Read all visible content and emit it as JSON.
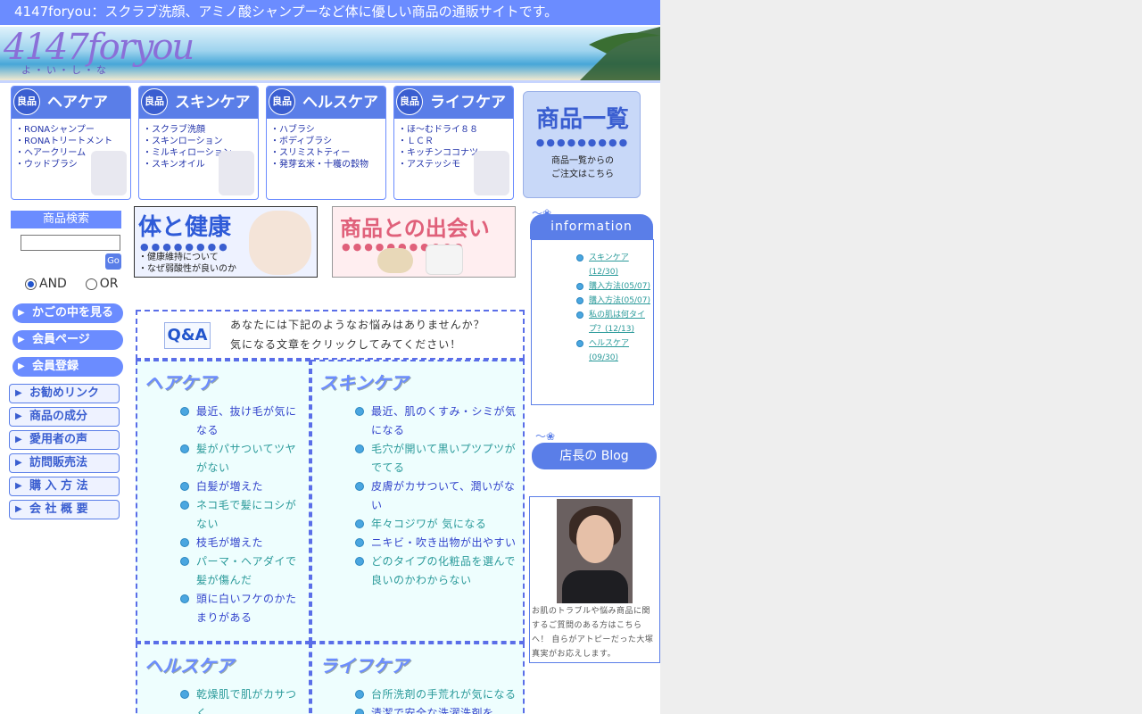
{
  "header": {
    "title": "4147foryou：スクラブ洗顔、アミノ酸シャンプーなど体に優しい商品の通販サイトです。",
    "logo_main": "4147foryou",
    "logo_sub": "よ・い・し・な"
  },
  "categories": [
    {
      "badge": "良品",
      "title": "ヘアケア",
      "items": [
        "・RONAシャンプー",
        "・RONAトリートメント",
        "・ヘアークリーム",
        "・ウッドブラシ"
      ]
    },
    {
      "badge": "良品",
      "title": "スキンケア",
      "items": [
        "・スクラブ洗顔",
        "・スキンローション",
        "・ミルキィローション",
        "・スキンオイル"
      ]
    },
    {
      "badge": "良品",
      "title": "ヘルスケア",
      "items": [
        "・ハブラシ",
        "・ボディブラシ",
        "・スリミストティー",
        "・発芽玄米・十穫の穀物"
      ]
    },
    {
      "badge": "良品",
      "title": "ライフケア",
      "items": [
        "・ほ～むドライ８８",
        "・ＬＣＲ",
        "・キッチンココナツ",
        "・アステッシモ"
      ]
    }
  ],
  "item_list": {
    "title": "商品一覧",
    "dots": "●●●●●●●●●",
    "line1": "商品一覧からの",
    "line2": "ご注文はこちら"
  },
  "search": {
    "heading": "商品検索",
    "value": "",
    "go": "Go",
    "and_label": "AND",
    "or_label": "OR",
    "selected": "AND"
  },
  "nav_primary": [
    "かごの中を見る",
    "会員ページ",
    "会員登録"
  ],
  "nav_secondary": [
    "お勧めリンク",
    "商品の成分",
    "愛用者の声",
    "訪問販売法",
    "購 入 方 法",
    "会 社 概 要"
  ],
  "banners": {
    "health_title": "体と健康",
    "health_lines": [
      "・健康維持について",
      "・なぜ弱酸性が良いのか"
    ],
    "meet_title": "商品との出会い"
  },
  "qa": {
    "logo": "Q&A",
    "line1": "あなたには下記のようなお悩みはありませんか？",
    "line2": "気になる文章をクリックしてみてください！"
  },
  "sections": [
    {
      "title": "ヘアケア",
      "items": [
        "最近、抜け毛が気になる",
        "髪がパサついてツヤがない",
        "白髪が増えた",
        "ネコ毛で髪にコシがない",
        "枝毛が増えた",
        "パーマ・ヘアダイで髪が傷んだ",
        "頭に白いフケのかたまりがある"
      ]
    },
    {
      "title": "スキンケア",
      "items": [
        "最近、肌のくすみ・シミが気になる",
        "毛穴が開いて黒いプツプツがでてる",
        "皮膚がカサついて、潤いがない",
        "年々コジワが 気になる",
        "ニキビ・吹き出物が出やすい",
        "どのタイプの化粧品を選んで良いのかわからない"
      ]
    },
    {
      "title": "ヘルスケア",
      "items": [
        "乾燥肌で肌がカサつく"
      ]
    },
    {
      "title": "ライフケア",
      "items": [
        "台所洗剤の手荒れが気になる",
        "清潔で安全な洗濯洗剤を"
      ]
    }
  ],
  "information": {
    "heading": "information",
    "items": [
      "スキンケア(12/30)",
      "購入方法(05/07)",
      "購入方法(05/07)",
      "私の肌は何タイプ？(12/13)",
      "ヘルスケア(09/30)"
    ]
  },
  "blog": {
    "label": "店長の Blog"
  },
  "staff": {
    "text": "お肌のトラブルや悩み商品に関するご質問のある方はこちらへ！ 自らがアトピーだった大塚真実がお応えします。"
  }
}
